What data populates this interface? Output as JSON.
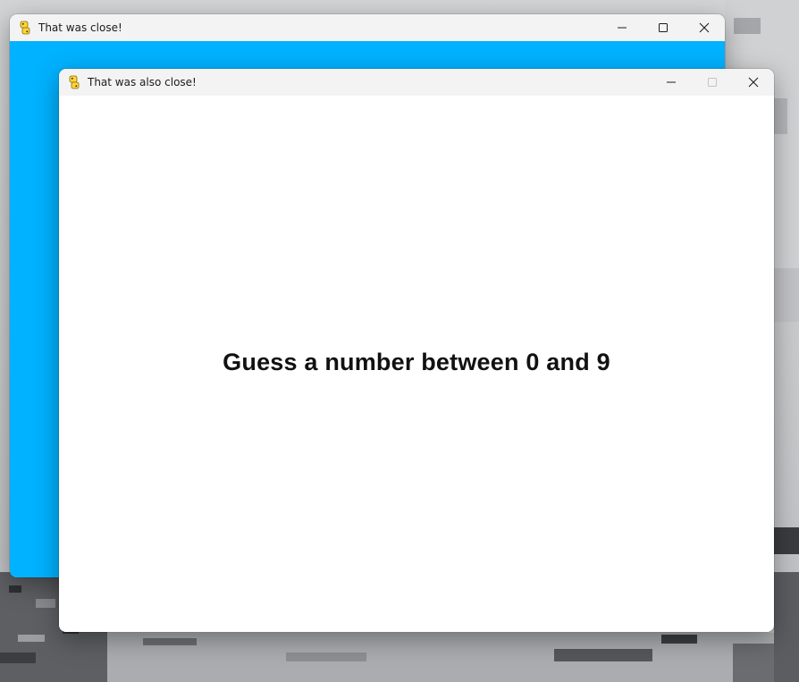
{
  "back_window": {
    "title": "That was close!",
    "client_color": "#00b2ff",
    "icon": "python-icon"
  },
  "front_window": {
    "title": "That was also close!",
    "client_color": "#ffffff",
    "icon": "python-icon",
    "prompt": "Guess a number between 0 and 9"
  },
  "controls": {
    "minimize_icon": "minimize-icon",
    "maximize_icon": "maximize-icon",
    "close_icon": "close-icon"
  }
}
